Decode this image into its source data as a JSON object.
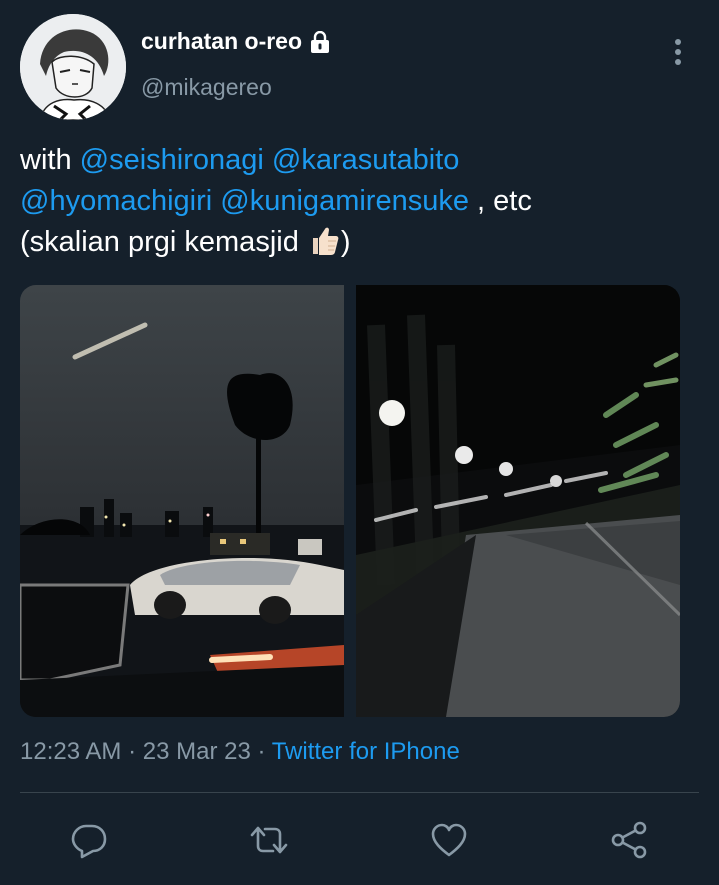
{
  "tweet": {
    "display_name": "curhatan o-reo",
    "handle": "@mikagereo",
    "text_prefix": "with",
    "mentions": [
      "@seishironagi",
      "@karasutabito",
      "@hyomachigiri",
      "@kunigamirensuke"
    ],
    "text_after_mentions": ", etc",
    "text_line3": "(skalian prgi kemasjid",
    "text_line3_end": ")",
    "emoji_icon": "thumbs-up-emoji",
    "time": "12:23 AM",
    "date": "23 Mar 23",
    "separator": "·",
    "source": "Twitter for IPhone"
  },
  "icons": {
    "lock": "lock-icon",
    "more": "vertical-more-icon",
    "reply": "reply-icon",
    "retweet": "retweet-icon",
    "like": "like-icon",
    "share": "share-icon"
  },
  "colors": {
    "background": "#15202b",
    "text": "#ffffff",
    "secondary": "#8899a6",
    "accent": "#1d9bf0",
    "divider": "#38444d"
  }
}
